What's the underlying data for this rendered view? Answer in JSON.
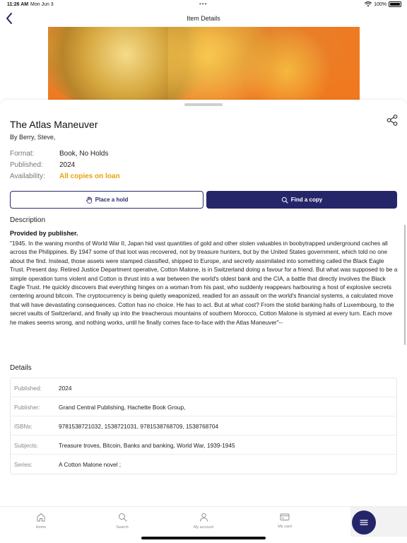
{
  "status_bar": {
    "time": "11:26 AM",
    "date": "Mon Jun 3",
    "battery": "100%"
  },
  "nav": {
    "title": "Item Details"
  },
  "item": {
    "title": "The Atlas Maneuver",
    "author": "By Berry, Steve,",
    "format_label": "Format:",
    "format_value": "Book, No Holds",
    "published_label": "Published:",
    "published_value": "2024",
    "availability_label": "Availability:",
    "availability_value": "All copies on loan"
  },
  "actions": {
    "place_hold": "Place a hold",
    "find_copy": "Find a copy"
  },
  "description": {
    "heading": "Description",
    "provided_by": "Provided by publisher.",
    "text": "\"1945. In the waning months of World War II, Japan hid vast quantities of gold and other stolen valuables in boobytrapped underground caches all across the Philippines. By 1947 some of that loot was recovered, not by treasure hunters, but by the United States government, which told no one about the find. Instead, those assets were stamped classified, shipped to Europe, and secretly assimilated into something called the Black Eagle Trust. Present day. Retired Justice Department operative, Cotton Malone, is in Switzerland doing a favour for a friend. But what was supposed to be a simple operation turns violent and Cotton is thrust into a war between the world's oldest bank and the CIA, a battle that directly involves the Black Eagle Trust. He quickly discovers that everything hinges on a woman from his past, who suddenly reappears harbouring a host of explosive secrets centering around bitcoin. The cryptocurrency is being quietly weaponized, readied for an assault on the world's financial systems, a calculated move that will have devastating consequences. Cotton has no choice. He has to act. But at what cost? From the stolid banking halls of Luxembourg, to the secret vaults of Switzerland, and finally up into the treacherous mountains of southern Morocco, Cotton Malone is stymied at every turn. Each move he makes seems wrong, and nothing works, until he finally comes face-to-face with the Atlas Maneuver\"--"
  },
  "details": {
    "heading": "Details",
    "rows": [
      {
        "key": "Published:",
        "value": "2024"
      },
      {
        "key": "Publisher:",
        "value": "Grand Central Publishing, Hachette Book Group,"
      },
      {
        "key": "ISBNs:",
        "value": "9781538721032, 1538721031, 9781538768709, 1538768704"
      },
      {
        "key": "Subjects:",
        "value": "Treasure troves, Bitcoin, Banks and banking, World War, 1939-1945"
      },
      {
        "key": "Series:",
        "value": "A Cotton Malone novel ;"
      }
    ]
  },
  "tabs": [
    {
      "label": "Home",
      "icon": "home-icon"
    },
    {
      "label": "Search",
      "icon": "search-icon"
    },
    {
      "label": "My account",
      "icon": "person-icon"
    },
    {
      "label": "My card",
      "icon": "card-icon"
    }
  ],
  "colors": {
    "accent": "#25266a",
    "availability": "#e8a20b"
  }
}
